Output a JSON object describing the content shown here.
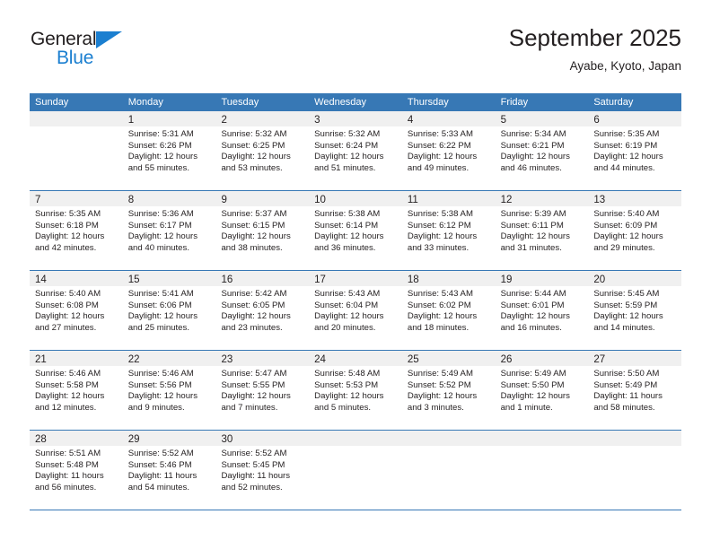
{
  "brand": {
    "name_part1": "General",
    "name_part2": "Blue",
    "triangle_color": "#1b7fd0"
  },
  "header": {
    "title": "September 2025",
    "subtitle": "Ayabe, Kyoto, Japan"
  },
  "theme": {
    "header_blue": "#3778b5",
    "daynum_band": "#f0f0f0",
    "text": "#231f20",
    "brand_blue": "#1b7fd0"
  },
  "weekdays": [
    "Sunday",
    "Monday",
    "Tuesday",
    "Wednesday",
    "Thursday",
    "Friday",
    "Saturday"
  ],
  "labels": {
    "sunrise_prefix": "Sunrise:",
    "sunset_prefix": "Sunset:",
    "daylight_prefix": "Daylight:"
  },
  "weeks": [
    [
      {
        "day": "",
        "sunrise": "",
        "sunset": "",
        "daylight_line1": "",
        "daylight_line2": ""
      },
      {
        "day": "1",
        "sunrise": "Sunrise: 5:31 AM",
        "sunset": "Sunset: 6:26 PM",
        "daylight_line1": "Daylight: 12 hours",
        "daylight_line2": "and 55 minutes."
      },
      {
        "day": "2",
        "sunrise": "Sunrise: 5:32 AM",
        "sunset": "Sunset: 6:25 PM",
        "daylight_line1": "Daylight: 12 hours",
        "daylight_line2": "and 53 minutes."
      },
      {
        "day": "3",
        "sunrise": "Sunrise: 5:32 AM",
        "sunset": "Sunset: 6:24 PM",
        "daylight_line1": "Daylight: 12 hours",
        "daylight_line2": "and 51 minutes."
      },
      {
        "day": "4",
        "sunrise": "Sunrise: 5:33 AM",
        "sunset": "Sunset: 6:22 PM",
        "daylight_line1": "Daylight: 12 hours",
        "daylight_line2": "and 49 minutes."
      },
      {
        "day": "5",
        "sunrise": "Sunrise: 5:34 AM",
        "sunset": "Sunset: 6:21 PM",
        "daylight_line1": "Daylight: 12 hours",
        "daylight_line2": "and 46 minutes."
      },
      {
        "day": "6",
        "sunrise": "Sunrise: 5:35 AM",
        "sunset": "Sunset: 6:19 PM",
        "daylight_line1": "Daylight: 12 hours",
        "daylight_line2": "and 44 minutes."
      }
    ],
    [
      {
        "day": "7",
        "sunrise": "Sunrise: 5:35 AM",
        "sunset": "Sunset: 6:18 PM",
        "daylight_line1": "Daylight: 12 hours",
        "daylight_line2": "and 42 minutes."
      },
      {
        "day": "8",
        "sunrise": "Sunrise: 5:36 AM",
        "sunset": "Sunset: 6:17 PM",
        "daylight_line1": "Daylight: 12 hours",
        "daylight_line2": "and 40 minutes."
      },
      {
        "day": "9",
        "sunrise": "Sunrise: 5:37 AM",
        "sunset": "Sunset: 6:15 PM",
        "daylight_line1": "Daylight: 12 hours",
        "daylight_line2": "and 38 minutes."
      },
      {
        "day": "10",
        "sunrise": "Sunrise: 5:38 AM",
        "sunset": "Sunset: 6:14 PM",
        "daylight_line1": "Daylight: 12 hours",
        "daylight_line2": "and 36 minutes."
      },
      {
        "day": "11",
        "sunrise": "Sunrise: 5:38 AM",
        "sunset": "Sunset: 6:12 PM",
        "daylight_line1": "Daylight: 12 hours",
        "daylight_line2": "and 33 minutes."
      },
      {
        "day": "12",
        "sunrise": "Sunrise: 5:39 AM",
        "sunset": "Sunset: 6:11 PM",
        "daylight_line1": "Daylight: 12 hours",
        "daylight_line2": "and 31 minutes."
      },
      {
        "day": "13",
        "sunrise": "Sunrise: 5:40 AM",
        "sunset": "Sunset: 6:09 PM",
        "daylight_line1": "Daylight: 12 hours",
        "daylight_line2": "and 29 minutes."
      }
    ],
    [
      {
        "day": "14",
        "sunrise": "Sunrise: 5:40 AM",
        "sunset": "Sunset: 6:08 PM",
        "daylight_line1": "Daylight: 12 hours",
        "daylight_line2": "and 27 minutes."
      },
      {
        "day": "15",
        "sunrise": "Sunrise: 5:41 AM",
        "sunset": "Sunset: 6:06 PM",
        "daylight_line1": "Daylight: 12 hours",
        "daylight_line2": "and 25 minutes."
      },
      {
        "day": "16",
        "sunrise": "Sunrise: 5:42 AM",
        "sunset": "Sunset: 6:05 PM",
        "daylight_line1": "Daylight: 12 hours",
        "daylight_line2": "and 23 minutes."
      },
      {
        "day": "17",
        "sunrise": "Sunrise: 5:43 AM",
        "sunset": "Sunset: 6:04 PM",
        "daylight_line1": "Daylight: 12 hours",
        "daylight_line2": "and 20 minutes."
      },
      {
        "day": "18",
        "sunrise": "Sunrise: 5:43 AM",
        "sunset": "Sunset: 6:02 PM",
        "daylight_line1": "Daylight: 12 hours",
        "daylight_line2": "and 18 minutes."
      },
      {
        "day": "19",
        "sunrise": "Sunrise: 5:44 AM",
        "sunset": "Sunset: 6:01 PM",
        "daylight_line1": "Daylight: 12 hours",
        "daylight_line2": "and 16 minutes."
      },
      {
        "day": "20",
        "sunrise": "Sunrise: 5:45 AM",
        "sunset": "Sunset: 5:59 PM",
        "daylight_line1": "Daylight: 12 hours",
        "daylight_line2": "and 14 minutes."
      }
    ],
    [
      {
        "day": "21",
        "sunrise": "Sunrise: 5:46 AM",
        "sunset": "Sunset: 5:58 PM",
        "daylight_line1": "Daylight: 12 hours",
        "daylight_line2": "and 12 minutes."
      },
      {
        "day": "22",
        "sunrise": "Sunrise: 5:46 AM",
        "sunset": "Sunset: 5:56 PM",
        "daylight_line1": "Daylight: 12 hours",
        "daylight_line2": "and 9 minutes."
      },
      {
        "day": "23",
        "sunrise": "Sunrise: 5:47 AM",
        "sunset": "Sunset: 5:55 PM",
        "daylight_line1": "Daylight: 12 hours",
        "daylight_line2": "and 7 minutes."
      },
      {
        "day": "24",
        "sunrise": "Sunrise: 5:48 AM",
        "sunset": "Sunset: 5:53 PM",
        "daylight_line1": "Daylight: 12 hours",
        "daylight_line2": "and 5 minutes."
      },
      {
        "day": "25",
        "sunrise": "Sunrise: 5:49 AM",
        "sunset": "Sunset: 5:52 PM",
        "daylight_line1": "Daylight: 12 hours",
        "daylight_line2": "and 3 minutes."
      },
      {
        "day": "26",
        "sunrise": "Sunrise: 5:49 AM",
        "sunset": "Sunset: 5:50 PM",
        "daylight_line1": "Daylight: 12 hours",
        "daylight_line2": "and 1 minute."
      },
      {
        "day": "27",
        "sunrise": "Sunrise: 5:50 AM",
        "sunset": "Sunset: 5:49 PM",
        "daylight_line1": "Daylight: 11 hours",
        "daylight_line2": "and 58 minutes."
      }
    ],
    [
      {
        "day": "28",
        "sunrise": "Sunrise: 5:51 AM",
        "sunset": "Sunset: 5:48 PM",
        "daylight_line1": "Daylight: 11 hours",
        "daylight_line2": "and 56 minutes."
      },
      {
        "day": "29",
        "sunrise": "Sunrise: 5:52 AM",
        "sunset": "Sunset: 5:46 PM",
        "daylight_line1": "Daylight: 11 hours",
        "daylight_line2": "and 54 minutes."
      },
      {
        "day": "30",
        "sunrise": "Sunrise: 5:52 AM",
        "sunset": "Sunset: 5:45 PM",
        "daylight_line1": "Daylight: 11 hours",
        "daylight_line2": "and 52 minutes."
      },
      {
        "day": "",
        "sunrise": "",
        "sunset": "",
        "daylight_line1": "",
        "daylight_line2": ""
      },
      {
        "day": "",
        "sunrise": "",
        "sunset": "",
        "daylight_line1": "",
        "daylight_line2": ""
      },
      {
        "day": "",
        "sunrise": "",
        "sunset": "",
        "daylight_line1": "",
        "daylight_line2": ""
      },
      {
        "day": "",
        "sunrise": "",
        "sunset": "",
        "daylight_line1": "",
        "daylight_line2": ""
      }
    ]
  ]
}
